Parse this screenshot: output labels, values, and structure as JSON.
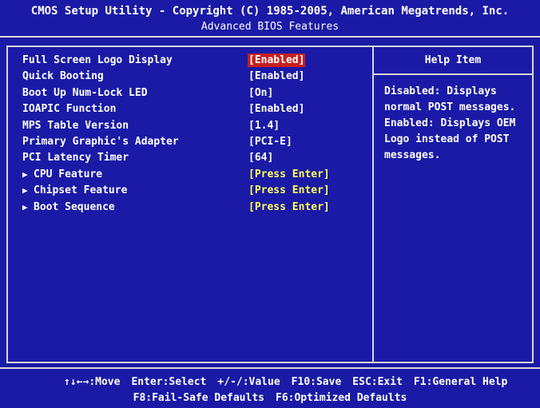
{
  "title": {
    "line1": "CMOS Setup Utility - Copyright (C) 1985-2005, American Megatrends, Inc.",
    "line2": "Advanced BIOS Features"
  },
  "settings": [
    {
      "label": "Full Screen Logo Display",
      "value": "[Enabled]",
      "submenu": false,
      "selected": true
    },
    {
      "label": "Quick Booting",
      "value": "[Enabled]",
      "submenu": false,
      "selected": false
    },
    {
      "label": "Boot Up Num-Lock LED",
      "value": "[On]",
      "submenu": false,
      "selected": false
    },
    {
      "label": "IOAPIC Function",
      "value": "[Enabled]",
      "submenu": false,
      "selected": false
    },
    {
      "label": "MPS Table Version",
      "value": "[1.4]",
      "submenu": false,
      "selected": false
    },
    {
      "label": "Primary Graphic's Adapter",
      "value": "[PCI-E]",
      "submenu": false,
      "selected": false
    },
    {
      "label": "PCI Latency Timer",
      "value": "[64]",
      "submenu": false,
      "selected": false
    },
    {
      "label": "CPU Feature",
      "value": "[Press Enter]",
      "submenu": true,
      "selected": false
    },
    {
      "label": "Chipset Feature",
      "value": "[Press Enter]",
      "submenu": true,
      "selected": false
    },
    {
      "label": "Boot Sequence",
      "value": "[Press Enter]",
      "submenu": true,
      "selected": false
    }
  ],
  "help": {
    "title": "Help Item",
    "text": "Disabled: Displays\nnormal POST messages.\nEnabled: Displays OEM\nLogo instead of POST\nmessages."
  },
  "footer": {
    "keys_line1": [
      {
        "key": "↑↓←→",
        "action": ":Move"
      },
      {
        "key": "Enter",
        "action": ":Select"
      },
      {
        "key": "+/-/",
        "action": ":Value"
      },
      {
        "key": "F10",
        "action": ":Save"
      },
      {
        "key": "ESC",
        "action": ":Exit"
      },
      {
        "key": "F1",
        "action": ":General Help"
      }
    ],
    "keys_line2": [
      {
        "key": "F8",
        "action": ":Fail-Safe Defaults"
      },
      {
        "key": "F6",
        "action": ":Optimized Defaults"
      }
    ]
  },
  "colors": {
    "background": "#1a1aa6",
    "text": "#ffffff",
    "submenu_value": "#ffff55",
    "selection": "#c81e1e",
    "frame": "#d8d8d8"
  },
  "icons": {
    "submenu": "triangle-right-icon"
  }
}
